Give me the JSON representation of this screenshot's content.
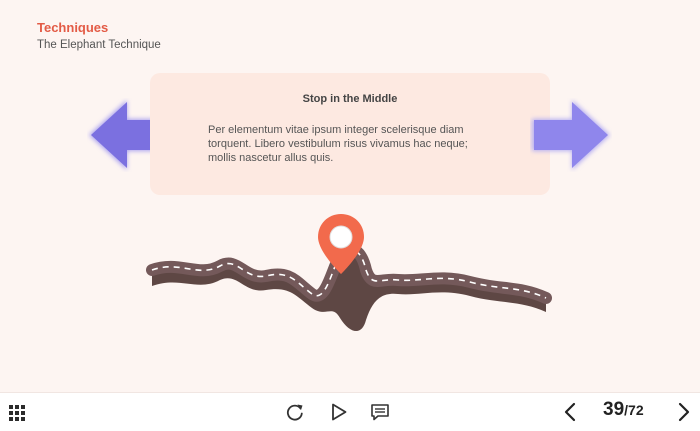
{
  "header": {
    "kicker": "Techniques",
    "subtitle": "The Elephant Technique"
  },
  "card": {
    "title": "Stop in the Middle",
    "body": "Per elementum vitae ipsum integer scelerisque diam torquent. Libero vestibulum risus vivamus hac neque; mollis nascetur allus quis."
  },
  "colors": {
    "accent": "#e35b46",
    "card_bg": "#fde9e1",
    "arrow": "#7b70e0",
    "road": "#5e4744",
    "pin": "#f26a4c"
  },
  "icons": {
    "menu": "grid-icon",
    "replay": "replay-icon",
    "play": "play-icon",
    "notes": "notes-icon",
    "prev": "chevron-left-icon",
    "next": "chevron-right-icon",
    "left_arrow": "arrow-left-icon",
    "right_arrow": "arrow-right-icon"
  },
  "pagination": {
    "current": "39",
    "separator": "/",
    "total": "72"
  }
}
